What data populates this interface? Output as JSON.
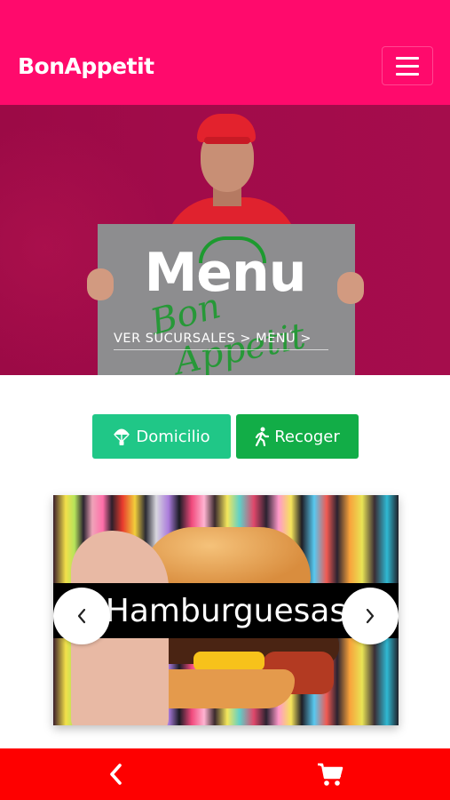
{
  "header": {
    "brand": "BonAppetit",
    "menu_icon": "hamburger-menu-icon",
    "background": "#ff0a6c"
  },
  "hero": {
    "title": "Menu",
    "breadcrumb": {
      "item1": "VER SUCURSALES",
      "separator1": ">",
      "item2": "MENÚ",
      "separator2": ">"
    },
    "sign_text_line1": "Bon",
    "sign_text_line2": "Appetit"
  },
  "order_buttons": {
    "delivery": {
      "label": "Domicilio",
      "icon": "parachute-icon",
      "color": "#20c787"
    },
    "pickup": {
      "label": "Recoger",
      "icon": "walking-person-icon",
      "color": "#12ad47"
    }
  },
  "carousel": {
    "caption": "Hamburguesas",
    "prev_icon": "chevron-left-icon",
    "next_icon": "chevron-right-icon"
  },
  "bottom_bar": {
    "back_icon": "chevron-left-icon",
    "cart_icon": "shopping-cart-icon",
    "background": "#fe0000"
  }
}
